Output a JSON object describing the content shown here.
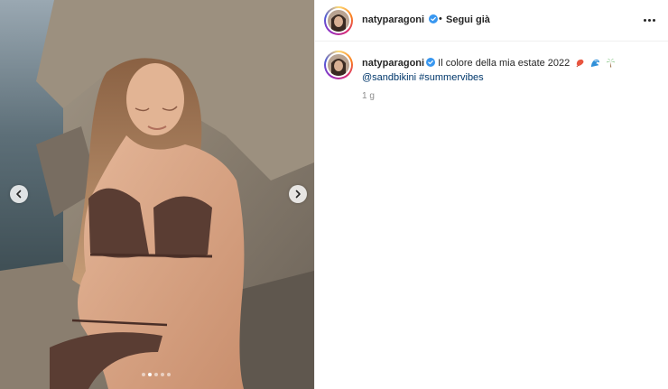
{
  "post": {
    "username": "natyparagoni",
    "separator": "•",
    "follow_label": "Segui già",
    "caption_text": "Il colore della mia estate 2022",
    "mention": "@sandbikini",
    "hashtag": "#summervibes",
    "time": "1 g"
  },
  "carousel": {
    "slide_count": 5,
    "active_slide": 2
  },
  "icons": {
    "verified": "verified-badge-icon",
    "more": "more-options-icon",
    "prev": "chevron-left-icon",
    "next": "chevron-right-icon",
    "caption_emojis": [
      "shrimp-emoji-icon",
      "wave-emoji-icon",
      "palm-tree-emoji-icon"
    ]
  },
  "colors": {
    "verified_blue": "#3897f0",
    "link_blue": "#00376b",
    "muted_gray": "#8e8e8e"
  }
}
